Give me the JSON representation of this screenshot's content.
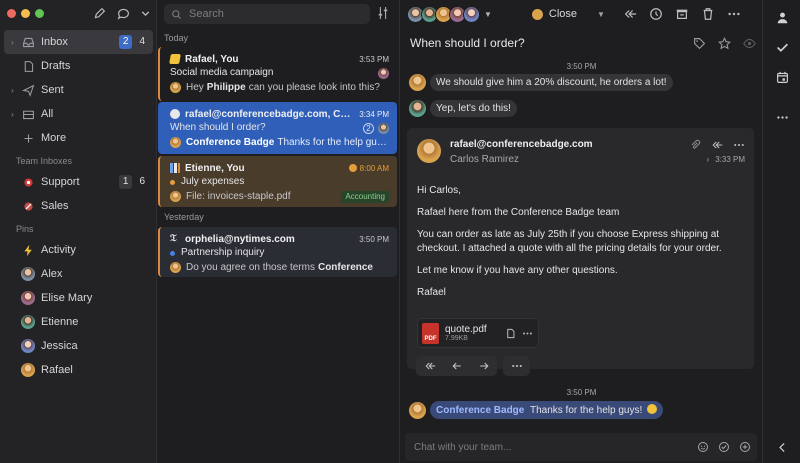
{
  "sidebar": {
    "nav": [
      {
        "label": "Inbox",
        "badge": "2",
        "count": "4"
      },
      {
        "label": "Drafts"
      },
      {
        "label": "Sent"
      },
      {
        "label": "All"
      },
      {
        "label": "More"
      }
    ],
    "team_inboxes_label": "Team Inboxes",
    "team_inboxes": [
      {
        "label": "Support",
        "badge": "1",
        "count": "6"
      },
      {
        "label": "Sales"
      }
    ],
    "pins_label": "Pins",
    "pins": [
      {
        "label": "Activity"
      },
      {
        "label": "Alex"
      },
      {
        "label": "Elise Mary"
      },
      {
        "label": "Etienne"
      },
      {
        "label": "Jessica"
      },
      {
        "label": "Rafael"
      }
    ]
  },
  "list": {
    "search_placeholder": "Search",
    "today_label": "Today",
    "yesterday_label": "Yesterday",
    "cards": [
      {
        "who": "Rafael, You",
        "time": "3:53 PM",
        "subject": "Social media campaign",
        "preview_name": "Philippe",
        "preview_prefix": "Hey",
        "preview_text": "can you please look into this?"
      },
      {
        "who": "rafael@conferencebadge.com, Carlos",
        "time": "3:34 PM",
        "subject": "When should I order?",
        "count": "2",
        "preview_name": "Conference Badge",
        "preview_text": "Thanks for the help guys!"
      },
      {
        "who": "Etienne, You",
        "time": "8:00 AM",
        "subject": "July expenses",
        "preview_text": "File: invoices-staple.pdf",
        "tag": "Accounting"
      },
      {
        "who": "orphelia@nytimes.com",
        "time": "3:50 PM",
        "subject": "Partnership inquiry",
        "preview_text": "Do you agree on those terms",
        "preview_name": "Conference"
      }
    ]
  },
  "detail": {
    "close_label": "Close",
    "subject": "When should I order?",
    "chat": [
      {
        "time": "3:50 PM"
      },
      {
        "text": "We should give him a 20% discount, he orders a lot!"
      },
      {
        "text": "Yep, let's do this!"
      }
    ],
    "email": {
      "from": "rafael@conferencebadge.com",
      "to": "Carlos Ramirez",
      "time": "3:33 PM",
      "greeting": "Hi Carlos,",
      "p1": "Rafael here from the Conference Badge team",
      "p2": "You can order as late as July 25th if you choose Express shipping at checkout. I attached a quote with all the pricing details for your order.",
      "p3": "Let me know if you have any other questions.",
      "sign": "Rafael",
      "attachment_name": "quote.pdf",
      "attachment_size": "7.99KB",
      "attachment_type": "PDF"
    },
    "bottom_time": "3:50 PM",
    "bottom_name": "Conference Badge",
    "bottom_text": "Thanks for the help guys!",
    "chat_placeholder": "Chat with your team..."
  },
  "colors": {
    "accent": "#2f5fb8",
    "orange_bar": "#d9893c",
    "brown_card": "#4a3c2b"
  }
}
